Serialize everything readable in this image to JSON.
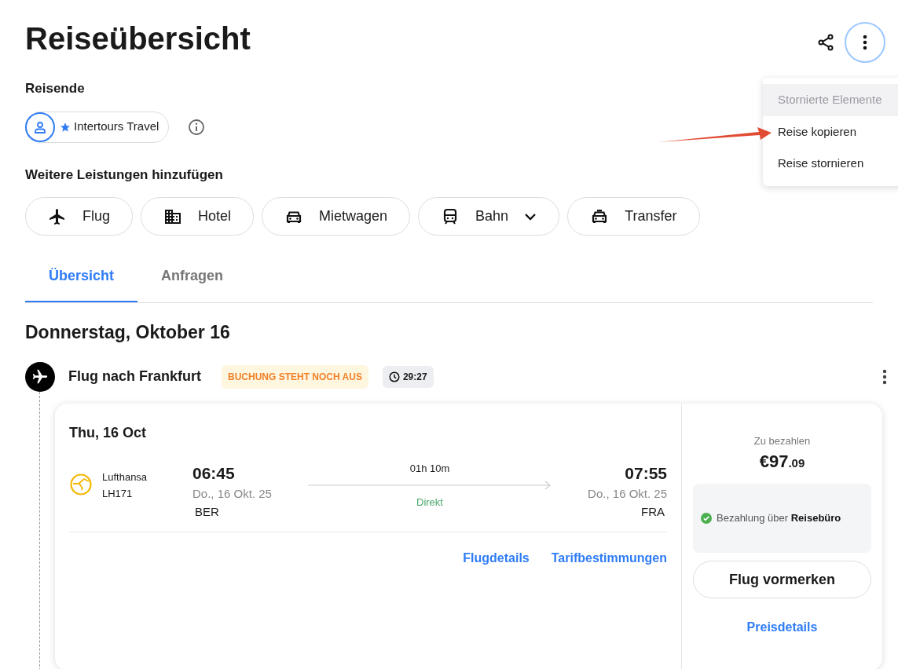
{
  "page_title": "Reiseübersicht",
  "menu": {
    "items": [
      {
        "label": "Stornierte Elemente",
        "disabled": true
      },
      {
        "label": "Reise kopieren",
        "disabled": false
      },
      {
        "label": "Reise stornieren",
        "disabled": false
      }
    ]
  },
  "travelers": {
    "heading": "Reisende",
    "chips": [
      {
        "name": "Intertours Travel",
        "starred": true
      }
    ]
  },
  "add_services": {
    "heading": "Weitere Leistungen hinzufügen",
    "buttons": [
      {
        "kind": "plane",
        "label": "Flug",
        "dropdown": false
      },
      {
        "kind": "building",
        "label": "Hotel",
        "dropdown": false
      },
      {
        "kind": "car",
        "label": "Mietwagen",
        "dropdown": false
      },
      {
        "kind": "train",
        "label": "Bahn",
        "dropdown": true
      },
      {
        "kind": "taxi",
        "label": "Transfer",
        "dropdown": false
      }
    ]
  },
  "tabs": [
    {
      "label": "Übersicht",
      "selected": true
    },
    {
      "label": "Anfragen",
      "selected": false
    }
  ],
  "day_heading": "Donnerstag, Oktober 16",
  "segment": {
    "title": "Flug nach Frankfurt",
    "status": "BUCHUNG STEHT NOCH AUS",
    "timer": "29:27",
    "card": {
      "date": "Thu, 16 Oct",
      "airline": "Lufthansa",
      "flight_number": "LH171",
      "departure": {
        "time": "06:45",
        "date": "Do., 16 Okt. 25",
        "airport": "BER"
      },
      "duration": "01h 10m",
      "stops": "Direkt",
      "arrival": {
        "time": "07:55",
        "date": "Do., 16 Okt. 25",
        "airport": "FRA"
      },
      "links": [
        "Flugdetails",
        "Tarifbestimmungen"
      ],
      "price_label": "Zu bezahlen",
      "price_main": "€97",
      "price_cents": ".09",
      "payment_note": "Bezahlung über **Reisebüro**",
      "book_button": "Flug vormerken",
      "price_details": "Preisdetails"
    }
  }
}
